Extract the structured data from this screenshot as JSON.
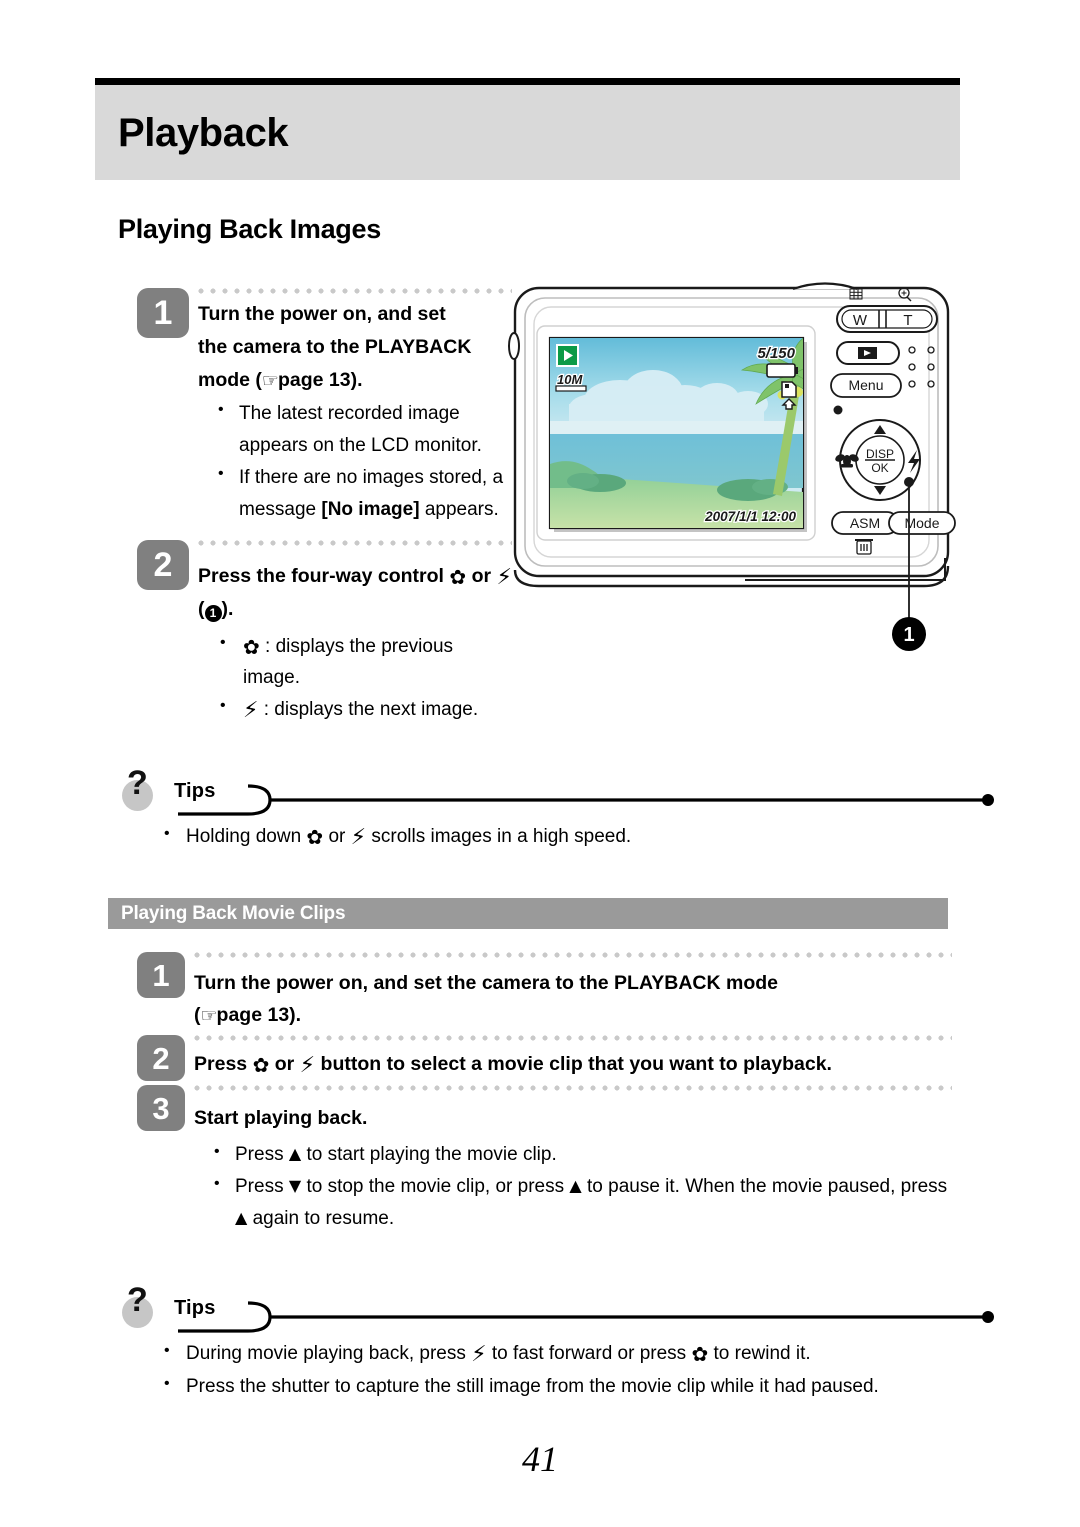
{
  "document": {
    "chapter_title": "Playback",
    "page_number": "41"
  },
  "section": {
    "title": "Playing Back Images"
  },
  "steps_images": [
    {
      "number": "1",
      "heading_line1": "Turn the power on, and set",
      "heading_line2": "the camera to the PLAYBACK",
      "heading_line3_pre": "mode (",
      "heading_page_ref": "page 13",
      "heading_line3_post": ").",
      "bullets": [
        {
          "text": "The latest recorded image appears on the LCD monitor."
        },
        {
          "pre": "If there are no images stored, a message ",
          "bold": "[No image]",
          "post": " appears."
        }
      ]
    },
    {
      "number": "2",
      "heading_pre": "Press the four-way control ",
      "heading_mid": " or ",
      "heading_post": " (",
      "heading_end": ").",
      "callout": "1",
      "bullets": [
        {
          "post": " : displays the previous image.",
          "icon": "macro-icon"
        },
        {
          "post": " : displays the next image.",
          "icon": "flash-icon"
        }
      ]
    }
  ],
  "tips_images": {
    "label": "Tips",
    "bullets": [
      {
        "pre": "Holding down ",
        "mid": " or ",
        "post": " scrolls images in a high speed."
      }
    ]
  },
  "subsection": {
    "title": "Playing Back Movie Clips"
  },
  "steps_movie": [
    {
      "number": "1",
      "heading_line1": "Turn the power on, and set the camera to the PLAYBACK mode",
      "heading_line2_pre": "(",
      "heading_page_ref": "page 13",
      "heading_line2_post": ")."
    },
    {
      "number": "2",
      "heading_pre": "Press ",
      "heading_mid": " or ",
      "heading_post": " button to select a movie clip that you want to playback."
    },
    {
      "number": "3",
      "heading": "Start playing back.",
      "bullets": [
        {
          "pre": "Press ",
          "post": " to start playing the movie clip."
        },
        {
          "pre": "Press ",
          "mid": " to stop the movie clip, or press ",
          "post": " to pause it. When the movie paused, press ",
          "end": " again to resume."
        }
      ]
    }
  ],
  "tips_movie": {
    "label": "Tips",
    "bullets": [
      {
        "pre": "During movie playing back, press ",
        "mid": " to fast forward or press ",
        "post": " to rewind it."
      },
      {
        "text": "Press the shutter to capture the still image from the movie clip while it had paused."
      }
    ]
  },
  "camera": {
    "lcd": {
      "mode_icon": "playback-mode-icon",
      "resolution_badge": "10M",
      "frame_counter": "5/150",
      "battery_icon": "battery-full-icon",
      "card_icon": "memory-card-icon",
      "protect_icon": "protect-icon",
      "datestamp": "2007/1/1 12:00"
    },
    "controls": {
      "zoom_wide": "W",
      "zoom_tele": "T",
      "thumbnail_icon": "thumbnail-grid-icon",
      "magnify_icon": "magnifier-icon",
      "playback_button": "playback-icon",
      "menu_button": "Menu",
      "fourway_center_top": "DISP",
      "fourway_center_bottom": "OK",
      "fourway_left": "macro-icon",
      "fourway_right": "flash-icon",
      "fourway_up": "up-arrow-icon",
      "fourway_down": "down-arrow-icon",
      "asm_button": "ASM",
      "mode_button": "Mode",
      "trash_icon": "trash-icon"
    },
    "callout_label": "1"
  },
  "colors": {
    "chapter_band": "#d9d9d9",
    "subsection_bar": "#9a9a9a",
    "step_badge": "#808080",
    "lcd_mode_green": "#0c9a46",
    "dot_gray": "#c9c9c9"
  }
}
